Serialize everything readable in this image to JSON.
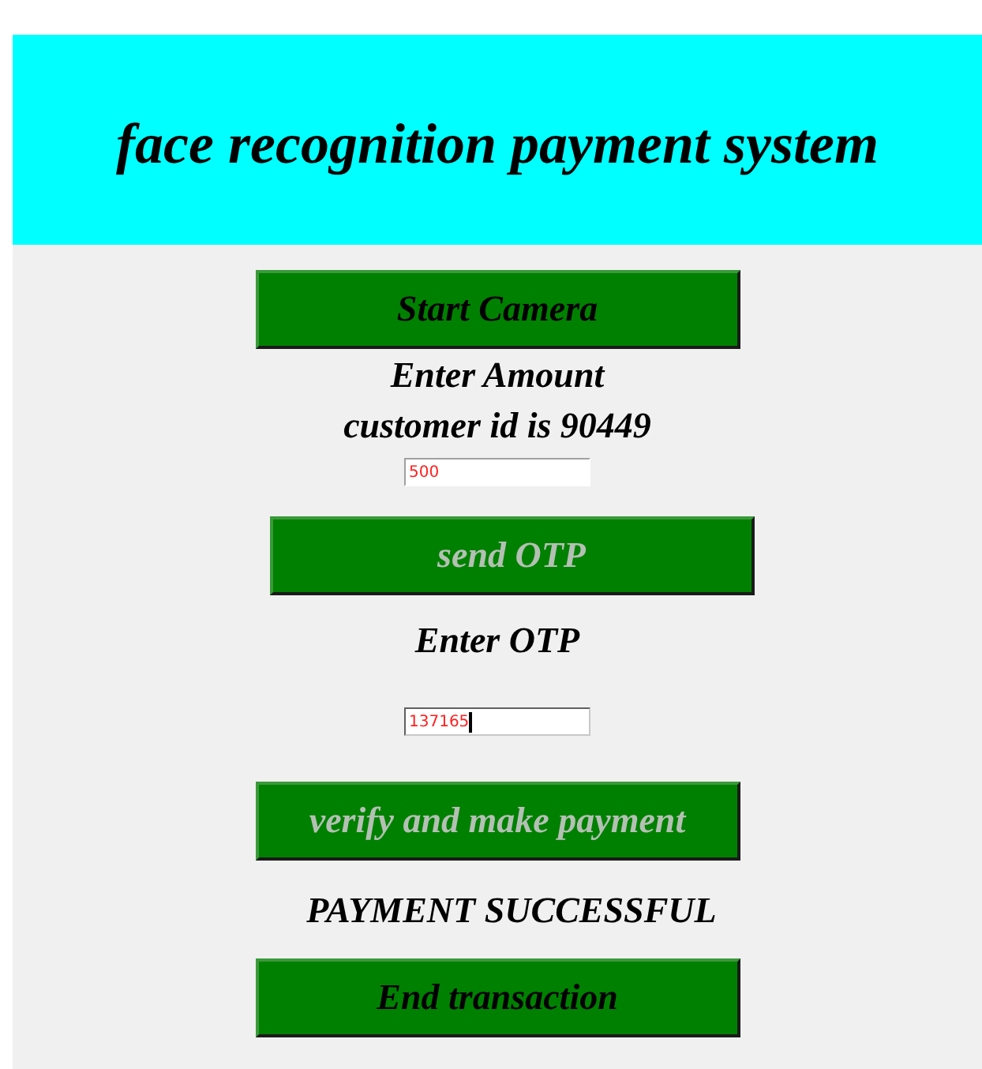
{
  "header": {
    "title": "face recognition payment system"
  },
  "items": [
    {
      "kind": "button",
      "label": "Start Camera",
      "disabled": false
    },
    {
      "kind": "label",
      "text": "Enter Amount"
    },
    {
      "kind": "label",
      "text": "customer id is 90449"
    },
    {
      "kind": "field",
      "value": "500",
      "focused": false
    },
    {
      "kind": "button",
      "label": "send OTP",
      "disabled": true
    },
    {
      "kind": "label",
      "text": "Enter OTP"
    },
    {
      "kind": "field",
      "value": "137165",
      "focused": true
    },
    {
      "kind": "button",
      "label": "verify and make payment",
      "disabled": true
    },
    {
      "kind": "label",
      "text": "PAYMENT SUCCESSFUL"
    },
    {
      "kind": "button",
      "label": "End transaction",
      "disabled": false
    }
  ]
}
